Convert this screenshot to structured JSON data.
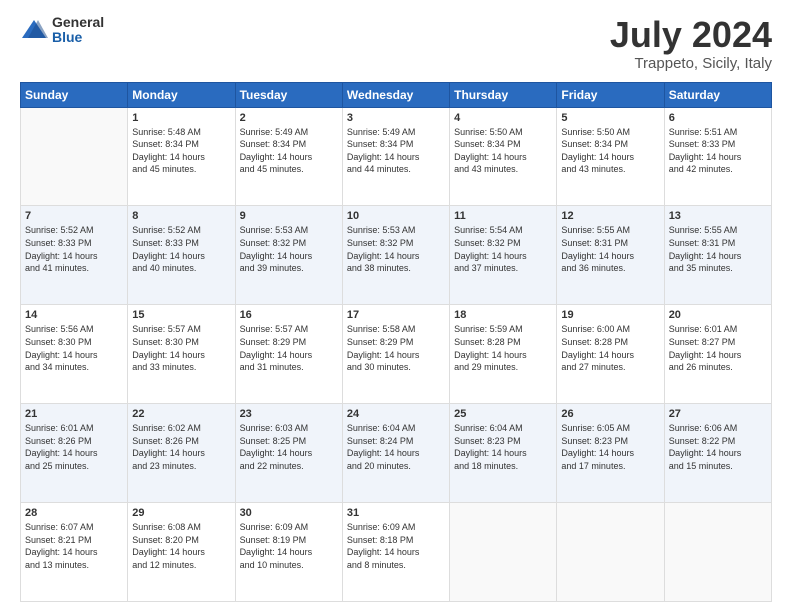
{
  "logo": {
    "general": "General",
    "blue": "Blue"
  },
  "header": {
    "month": "July 2024",
    "location": "Trappeto, Sicily, Italy"
  },
  "days": [
    "Sunday",
    "Monday",
    "Tuesday",
    "Wednesday",
    "Thursday",
    "Friday",
    "Saturday"
  ],
  "weeks": [
    [
      {
        "num": "",
        "sunrise": "",
        "sunset": "",
        "daylight": ""
      },
      {
        "num": "1",
        "sunrise": "Sunrise: 5:48 AM",
        "sunset": "Sunset: 8:34 PM",
        "daylight": "Daylight: 14 hours and 45 minutes."
      },
      {
        "num": "2",
        "sunrise": "Sunrise: 5:49 AM",
        "sunset": "Sunset: 8:34 PM",
        "daylight": "Daylight: 14 hours and 45 minutes."
      },
      {
        "num": "3",
        "sunrise": "Sunrise: 5:49 AM",
        "sunset": "Sunset: 8:34 PM",
        "daylight": "Daylight: 14 hours and 44 minutes."
      },
      {
        "num": "4",
        "sunrise": "Sunrise: 5:50 AM",
        "sunset": "Sunset: 8:34 PM",
        "daylight": "Daylight: 14 hours and 43 minutes."
      },
      {
        "num": "5",
        "sunrise": "Sunrise: 5:50 AM",
        "sunset": "Sunset: 8:34 PM",
        "daylight": "Daylight: 14 hours and 43 minutes."
      },
      {
        "num": "6",
        "sunrise": "Sunrise: 5:51 AM",
        "sunset": "Sunset: 8:33 PM",
        "daylight": "Daylight: 14 hours and 42 minutes."
      }
    ],
    [
      {
        "num": "7",
        "sunrise": "Sunrise: 5:52 AM",
        "sunset": "Sunset: 8:33 PM",
        "daylight": "Daylight: 14 hours and 41 minutes."
      },
      {
        "num": "8",
        "sunrise": "Sunrise: 5:52 AM",
        "sunset": "Sunset: 8:33 PM",
        "daylight": "Daylight: 14 hours and 40 minutes."
      },
      {
        "num": "9",
        "sunrise": "Sunrise: 5:53 AM",
        "sunset": "Sunset: 8:32 PM",
        "daylight": "Daylight: 14 hours and 39 minutes."
      },
      {
        "num": "10",
        "sunrise": "Sunrise: 5:53 AM",
        "sunset": "Sunset: 8:32 PM",
        "daylight": "Daylight: 14 hours and 38 minutes."
      },
      {
        "num": "11",
        "sunrise": "Sunrise: 5:54 AM",
        "sunset": "Sunset: 8:32 PM",
        "daylight": "Daylight: 14 hours and 37 minutes."
      },
      {
        "num": "12",
        "sunrise": "Sunrise: 5:55 AM",
        "sunset": "Sunset: 8:31 PM",
        "daylight": "Daylight: 14 hours and 36 minutes."
      },
      {
        "num": "13",
        "sunrise": "Sunrise: 5:55 AM",
        "sunset": "Sunset: 8:31 PM",
        "daylight": "Daylight: 14 hours and 35 minutes."
      }
    ],
    [
      {
        "num": "14",
        "sunrise": "Sunrise: 5:56 AM",
        "sunset": "Sunset: 8:30 PM",
        "daylight": "Daylight: 14 hours and 34 minutes."
      },
      {
        "num": "15",
        "sunrise": "Sunrise: 5:57 AM",
        "sunset": "Sunset: 8:30 PM",
        "daylight": "Daylight: 14 hours and 33 minutes."
      },
      {
        "num": "16",
        "sunrise": "Sunrise: 5:57 AM",
        "sunset": "Sunset: 8:29 PM",
        "daylight": "Daylight: 14 hours and 31 minutes."
      },
      {
        "num": "17",
        "sunrise": "Sunrise: 5:58 AM",
        "sunset": "Sunset: 8:29 PM",
        "daylight": "Daylight: 14 hours and 30 minutes."
      },
      {
        "num": "18",
        "sunrise": "Sunrise: 5:59 AM",
        "sunset": "Sunset: 8:28 PM",
        "daylight": "Daylight: 14 hours and 29 minutes."
      },
      {
        "num": "19",
        "sunrise": "Sunrise: 6:00 AM",
        "sunset": "Sunset: 8:28 PM",
        "daylight": "Daylight: 14 hours and 27 minutes."
      },
      {
        "num": "20",
        "sunrise": "Sunrise: 6:01 AM",
        "sunset": "Sunset: 8:27 PM",
        "daylight": "Daylight: 14 hours and 26 minutes."
      }
    ],
    [
      {
        "num": "21",
        "sunrise": "Sunrise: 6:01 AM",
        "sunset": "Sunset: 8:26 PM",
        "daylight": "Daylight: 14 hours and 25 minutes."
      },
      {
        "num": "22",
        "sunrise": "Sunrise: 6:02 AM",
        "sunset": "Sunset: 8:26 PM",
        "daylight": "Daylight: 14 hours and 23 minutes."
      },
      {
        "num": "23",
        "sunrise": "Sunrise: 6:03 AM",
        "sunset": "Sunset: 8:25 PM",
        "daylight": "Daylight: 14 hours and 22 minutes."
      },
      {
        "num": "24",
        "sunrise": "Sunrise: 6:04 AM",
        "sunset": "Sunset: 8:24 PM",
        "daylight": "Daylight: 14 hours and 20 minutes."
      },
      {
        "num": "25",
        "sunrise": "Sunrise: 6:04 AM",
        "sunset": "Sunset: 8:23 PM",
        "daylight": "Daylight: 14 hours and 18 minutes."
      },
      {
        "num": "26",
        "sunrise": "Sunrise: 6:05 AM",
        "sunset": "Sunset: 8:23 PM",
        "daylight": "Daylight: 14 hours and 17 minutes."
      },
      {
        "num": "27",
        "sunrise": "Sunrise: 6:06 AM",
        "sunset": "Sunset: 8:22 PM",
        "daylight": "Daylight: 14 hours and 15 minutes."
      }
    ],
    [
      {
        "num": "28",
        "sunrise": "Sunrise: 6:07 AM",
        "sunset": "Sunset: 8:21 PM",
        "daylight": "Daylight: 14 hours and 13 minutes."
      },
      {
        "num": "29",
        "sunrise": "Sunrise: 6:08 AM",
        "sunset": "Sunset: 8:20 PM",
        "daylight": "Daylight: 14 hours and 12 minutes."
      },
      {
        "num": "30",
        "sunrise": "Sunrise: 6:09 AM",
        "sunset": "Sunset: 8:19 PM",
        "daylight": "Daylight: 14 hours and 10 minutes."
      },
      {
        "num": "31",
        "sunrise": "Sunrise: 6:09 AM",
        "sunset": "Sunset: 8:18 PM",
        "daylight": "Daylight: 14 hours and 8 minutes."
      },
      {
        "num": "",
        "sunrise": "",
        "sunset": "",
        "daylight": ""
      },
      {
        "num": "",
        "sunrise": "",
        "sunset": "",
        "daylight": ""
      },
      {
        "num": "",
        "sunrise": "",
        "sunset": "",
        "daylight": ""
      }
    ]
  ]
}
